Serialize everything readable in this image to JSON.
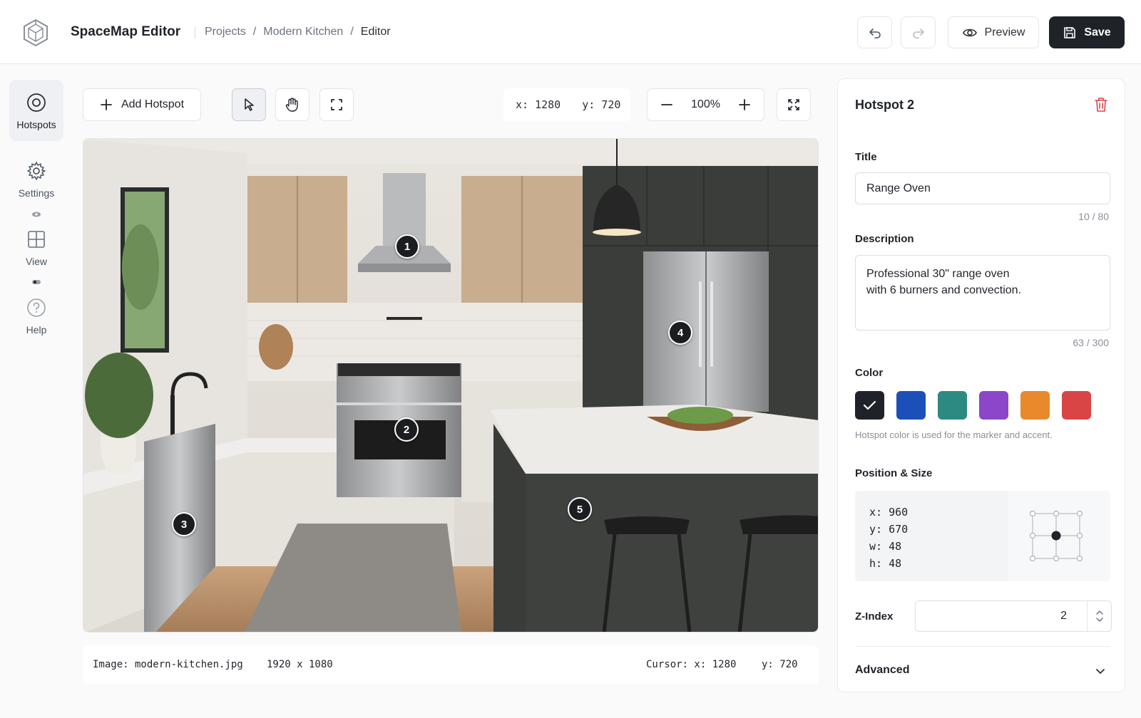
{
  "header": {
    "app_title": "SpaceMap Editor",
    "breadcrumb": [
      "Projects",
      "Modern Kitchen",
      "Editor"
    ],
    "preview_label": "Preview",
    "save_label": "Save"
  },
  "rail": [
    {
      "label": "Hotspots",
      "icon": "target-icon",
      "active": true
    },
    {
      "label": "Settings",
      "icon": "gear-icon"
    },
    {
      "label": "View",
      "icon": "grid-icon"
    },
    {
      "label": "Help",
      "icon": "help-icon"
    }
  ],
  "toolbar": {
    "add_hotspot_label": "Add Hotspot",
    "coord_x": "x: 1280",
    "coord_y": "y: 720",
    "zoom": "100%"
  },
  "canvas": {
    "hotspots": [
      "1",
      "2",
      "3",
      "4",
      "5"
    ]
  },
  "status": {
    "image": "Image: modern-kitchen.jpg",
    "dims": "1920 x 1080",
    "cursor_x": "Cursor: x: 1280",
    "cursor_y": "y: 720"
  },
  "panel": {
    "title": "Hotspot 2",
    "title_label": "Title",
    "title_value": "Range Oven",
    "title_counter": "10 / 80",
    "description_label": "Description",
    "description_value": "Professional 30\" range oven\nwith 6 burners and convection.",
    "description_counter": "63 / 300",
    "color_label": "Color",
    "colors": [
      "#1f2329",
      "#1d4fb8",
      "#2d8a82",
      "#8b46c9",
      "#e8892b",
      "#d94545"
    ],
    "selected_color": "#1f2329",
    "color_hint": "Hotspot color is used for the marker and accent.",
    "position_label": "Position & Size",
    "pos_x": "x: 960",
    "pos_y": "y: 670",
    "pos_w": "w: 48",
    "pos_h": "h: 48",
    "zindex_label": "Z-Index",
    "zindex_value": "2",
    "advanced_label": "Advanced"
  }
}
